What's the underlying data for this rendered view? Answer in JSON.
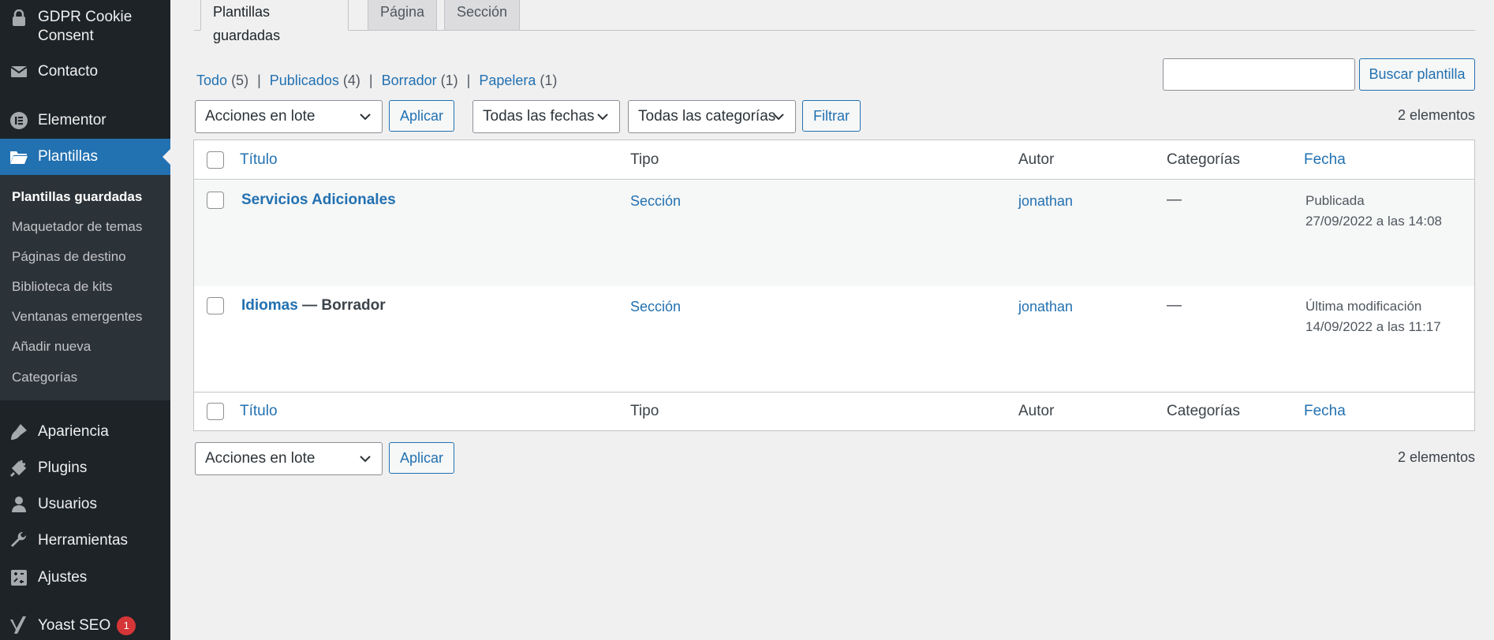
{
  "sidebar": {
    "items": [
      {
        "label": "GDPR Cookie Consent",
        "icon": "lock-icon"
      },
      {
        "label": "Contacto",
        "icon": "mail-icon"
      },
      {
        "label": "Elementor",
        "icon": "elementor-icon"
      },
      {
        "label": "Plantillas",
        "icon": "folder-icon"
      },
      {
        "label": "Apariencia",
        "icon": "paintbrush-icon"
      },
      {
        "label": "Plugins",
        "icon": "plugin-icon"
      },
      {
        "label": "Usuarios",
        "icon": "user-icon"
      },
      {
        "label": "Herramientas",
        "icon": "wrench-icon"
      },
      {
        "label": "Ajustes",
        "icon": "settings-icon"
      },
      {
        "label": "Yoast SEO",
        "icon": "yoast-icon",
        "badge": "1"
      }
    ],
    "submenu": [
      "Plantillas guardadas",
      "Maquetador de temas",
      "Páginas de destino",
      "Biblioteca de kits",
      "Ventanas emergentes",
      "Añadir nueva",
      "Categorías"
    ]
  },
  "tabs": [
    "Plantillas guardadas",
    "Página",
    "Sección"
  ],
  "views": {
    "all": {
      "label": "Todo",
      "count": "(5)"
    },
    "published": {
      "label": "Publicados",
      "count": "(4)"
    },
    "draft": {
      "label": "Borrador",
      "count": "(1)"
    },
    "trash": {
      "label": "Papelera",
      "count": "(1)"
    },
    "separator": "|"
  },
  "search": {
    "button": "Buscar plantilla",
    "value": ""
  },
  "filters": {
    "bulk_actions": "Acciones en lote",
    "apply": "Aplicar",
    "dates": "Todas las fechas",
    "categories": "Todas las categorías",
    "filter": "Filtrar"
  },
  "item_count": "2 elementos",
  "table": {
    "columns": {
      "title": "Título",
      "type": "Tipo",
      "author": "Autor",
      "categories": "Categorías",
      "date": "Fecha"
    },
    "rows": [
      {
        "title": "Servicios Adicionales",
        "state": "",
        "type": "Sección",
        "author": "jonathan",
        "categories": "—",
        "date_status": "Publicada",
        "date": "27/09/2022 a las 14:08"
      },
      {
        "title": "Idiomas",
        "state": "— Borrador",
        "type": "Sección",
        "author": "jonathan",
        "categories": "—",
        "date_status": "Última modificación",
        "date": "14/09/2022 a las 11:17"
      }
    ]
  },
  "colors": {
    "accent": "#2271b1",
    "sidebar": "#1d2327",
    "submenu": "#2c3338",
    "badge": "#d63638"
  }
}
